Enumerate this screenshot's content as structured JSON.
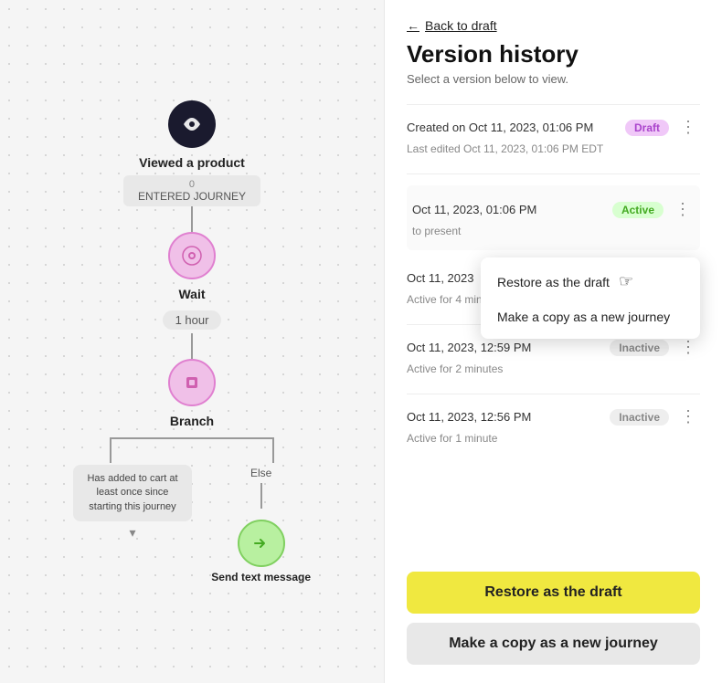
{
  "left": {
    "nodes": {
      "viewedProduct": {
        "label": "Viewed a product",
        "count": "0",
        "enteredLabel": "ENTERED JOURNEY"
      },
      "wait": {
        "label": "Wait",
        "duration": "1 hour"
      },
      "branch": {
        "label": "Branch"
      },
      "leftCondition": "Has added to cart at least once since starting this journey",
      "rightCondition": "Else",
      "sendLabel": "Send text message"
    }
  },
  "right": {
    "backLabel": "Back to draft",
    "title": "Version history",
    "subtitle": "Select a version below to view.",
    "headerVersion": {
      "createdLabel": "Created on Oct 11, 2023, 01:06 PM",
      "badgeDraft": "Draft",
      "lastEdited": "Last edited Oct 11, 2023, 01:06 PM EDT"
    },
    "versions": [
      {
        "date": "Oct 11, 2023, 01:06 PM",
        "badge": "Active",
        "badgeType": "active",
        "sub": "to present"
      },
      {
        "date": "Oct 11, 2023",
        "badge": "",
        "badgeType": "",
        "sub": "Active for 4 minu..."
      },
      {
        "date": "Oct 11, 2023, 12:59 PM",
        "badge": "Inactive",
        "badgeType": "inactive",
        "sub": "Active for 2 minutes"
      },
      {
        "date": "Oct 11, 2023, 12:56 PM",
        "badge": "Inactive",
        "badgeType": "inactive",
        "sub": "Active for 1 minute"
      }
    ],
    "contextMenu": {
      "restoreLabel": "Restore as the draft",
      "copyLabel": "Make a copy as a new journey"
    },
    "buttons": {
      "primary": "Restore as the draft",
      "secondary": "Make a copy as a new journey"
    }
  }
}
